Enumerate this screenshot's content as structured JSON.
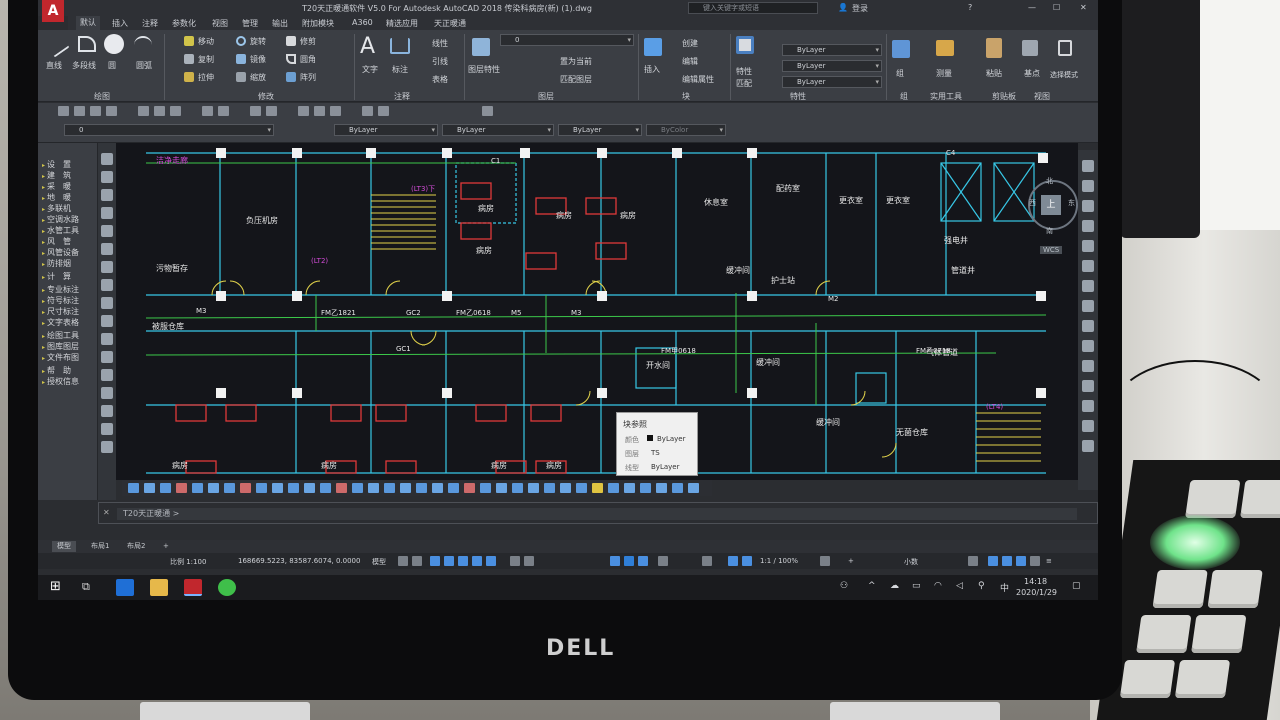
{
  "window": {
    "title": "T20天正暖通软件 V5.0 For Autodesk AutoCAD 2018    传染科病房(新) (1).dwg",
    "search_placeholder": "键入关键字或短语",
    "user": "登录"
  },
  "menu_tabs": [
    "默认",
    "插入",
    "注释",
    "参数化",
    "视图",
    "管理",
    "输出",
    "附加模块",
    "A360",
    "精选应用",
    "天正暖通"
  ],
  "ribbon": {
    "draw_tools": [
      "直线",
      "多段线",
      "圆",
      "圆弧"
    ],
    "modify_tools": [
      "移动",
      "旋转",
      "修剪",
      "复制",
      "镜像",
      "圆角",
      "拉伸",
      "缩放",
      "阵列"
    ],
    "annotation_tools": [
      "文字",
      "标注",
      "线性",
      "引线",
      "表格"
    ],
    "layer_tools": [
      "图层特性",
      "置为当前",
      "匹配图层"
    ],
    "block_tools": [
      "插入",
      "创建",
      "编辑",
      "编辑属性"
    ],
    "property_tools": [
      "特性",
      "匹配"
    ],
    "layer_value": "0",
    "bylayer_1": "ByLayer",
    "bylayer_2": "ByLayer",
    "bylayer_3": "ByLayer",
    "group_label": "组",
    "measure_label": "测量",
    "paste_label": "粘贴",
    "base_label": "基点",
    "select_mode": "选择模式",
    "panel_labels": [
      "绘图",
      "修改",
      "注释",
      "图层",
      "块",
      "特性",
      "组",
      "实用工具",
      "剪贴板",
      "视图"
    ]
  },
  "layer_toolbar": {
    "layer": "0",
    "color": "ByLayer",
    "linetype": "ByLayer",
    "lineweight": "ByLayer",
    "plotstyle": "ByColor"
  },
  "palette": [
    "设　置",
    "建　筑",
    "采　暖",
    "地　暖",
    "多联机",
    "空调水路",
    "水管工具",
    "风　管",
    "风管设备",
    "防排烟",
    "计　算",
    "专业标注",
    "符号标注",
    "尺寸标注",
    "文字表格",
    "绘图工具",
    "图库图层",
    "文件布图",
    "帮　助",
    "授权信息"
  ],
  "drawing_labels": {
    "rooms": [
      "负压机房",
      "病房",
      "病房",
      "病房",
      "病房",
      "休息室",
      "配药室",
      "更衣室",
      "更衣室",
      "缓冲间",
      "护士站",
      "污物暂存",
      "被服仓库",
      "开水间",
      "缓冲间",
      "缓冲间",
      "病房",
      "病房",
      "病房",
      "病房",
      "病房",
      "无菌仓库",
      "管道井",
      "气体管道",
      "强电井",
      "洁净走廊"
    ],
    "tags": [
      "(LT3)下",
      "(LT2)",
      "M3",
      "M3",
      "M5",
      "M2",
      "FM乙1821",
      "GC2",
      "FM乙0618",
      "FM甲0618",
      "FM乙0718",
      "GC1",
      "C1",
      "C4",
      "(LT4)"
    ]
  },
  "popup": {
    "title": "块参照",
    "rows": [
      {
        "key": "颜色",
        "value": "ByLayer"
      },
      {
        "key": "图层",
        "value": "TS"
      },
      {
        "key": "线型",
        "value": "ByLayer"
      }
    ]
  },
  "viewcube": {
    "face": "上",
    "north": "北",
    "south": "南",
    "east": "东",
    "west": "西",
    "wcs": "WCS"
  },
  "command": {
    "prompt": "T20天正暖通 >"
  },
  "layout_tabs": [
    "模型",
    "布局1",
    "布局2",
    "+"
  ],
  "status": {
    "scale": "比例 1:100",
    "coords": "168669.5223, 83587.6074, 0.0000",
    "space": "模型",
    "annotation_scale": "1:1 / 100%",
    "units": "小数"
  },
  "taskbar": {
    "time": "14:18",
    "date": "2020/1/29",
    "ime": "中",
    "notify_count": ""
  },
  "brand": "DELL",
  "colors": {
    "wall_cyan": "#37c7e6",
    "door_yellow": "#e3d44b",
    "bed_red": "#e03a3a",
    "pipe_green": "#3cc84a",
    "label_white": "#e8e8e8",
    "tag_magenta": "#d14bd6"
  }
}
